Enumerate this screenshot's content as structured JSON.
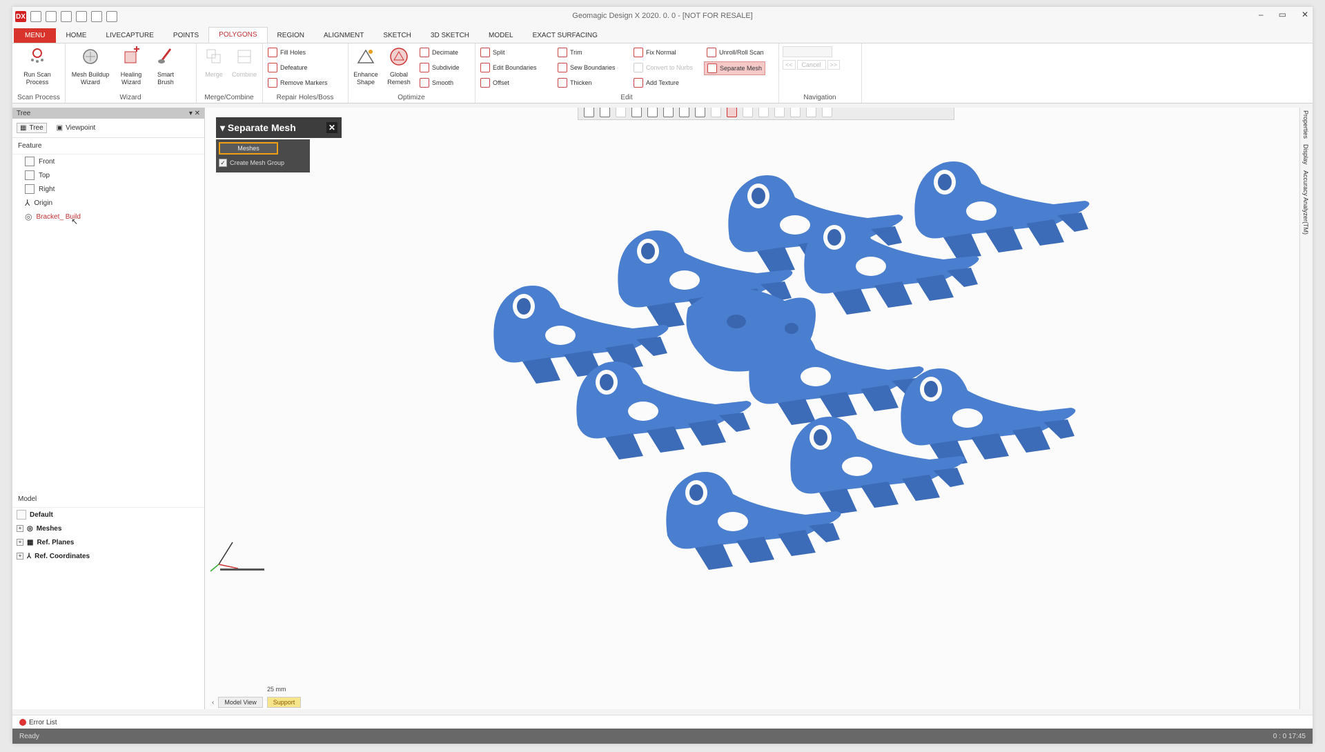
{
  "window": {
    "title": "Geomagic Design X 2020. 0. 0 - [NOT FOR RESALE]",
    "minimize": "–",
    "maximize": "▭",
    "close": "✕",
    "app_logo": "DX"
  },
  "tabs": [
    "MENU",
    "HOME",
    "LIVECAPTURE",
    "POINTS",
    "POLYGONS",
    "REGION",
    "ALIGNMENT",
    "SKETCH",
    "3D SKETCH",
    "MODEL",
    "EXACT SURFACING"
  ],
  "ribbon": {
    "scan_process": {
      "label": "Scan Process",
      "run_scan": "Run Scan Process"
    },
    "wizard": {
      "label": "Wizard",
      "mesh_buildup": "Mesh Buildup Wizard",
      "healing": "Healing Wizard",
      "smart_brush": "Smart Brush"
    },
    "merge_combine": {
      "label": "Merge/Combine",
      "merge": "Merge",
      "combine": "Combine"
    },
    "repair": {
      "label": "Repair Holes/Boss",
      "fill_holes": "Fill Holes",
      "defeature": "Defeature",
      "remove_markers": "Remove Markers"
    },
    "optimize": {
      "label": "Optimize",
      "enhance_shape": "Enhance Shape",
      "global_remesh": "Global Remesh",
      "decimate": "Decimate",
      "subdivide": "Subdivide",
      "smooth": "Smooth"
    },
    "edit": {
      "label": "Edit",
      "split": "Split",
      "edit_boundaries": "Edit Boundaries",
      "offset": "Offset",
      "trim": "Trim",
      "sew_boundaries": "Sew Boundaries",
      "thicken": "Thicken",
      "fix_normal": "Fix Normal",
      "convert_to_nurbs": "Convert to Nurbs",
      "add_texture": "Add Texture",
      "unroll_roll_scan": "Unroll/Roll Scan",
      "separate_mesh": "Separate Mesh"
    },
    "navigation": {
      "label": "Navigation",
      "prev": "<<",
      "cancel": "Cancel",
      "next": ">>"
    }
  },
  "tree_panel": {
    "title": "Tree",
    "tab_tree": "Tree",
    "tab_viewpoint": "Viewpoint",
    "feature_label": "Feature",
    "items": [
      "Front",
      "Top",
      "Right",
      "Origin",
      "Bracket_ Build"
    ],
    "model_label": "Model",
    "model_default": "Default",
    "model_items": [
      "Meshes",
      "Ref. Planes",
      "Ref. Coordinates"
    ]
  },
  "dialog": {
    "title": "Separate Mesh",
    "close": "✕",
    "meshes_field": "Meshes",
    "create_group_label": "Create Mesh Group",
    "checkmark": "✓"
  },
  "viewport": {
    "scale_label": "25 mm",
    "view_tabs": [
      "Model View",
      "Support"
    ],
    "mesh_color": "#4a7fd0"
  },
  "right_strip": [
    "Properties",
    "Display",
    "Accuracy Analyzer(TM)"
  ],
  "bottom": {
    "error_list": "Error List",
    "status": "Ready",
    "time": "0 : 0 17:45"
  },
  "colors": {
    "menu_red": "#d9342b",
    "accent": "#c03030",
    "mesh_blue": "#4a7fd0"
  }
}
